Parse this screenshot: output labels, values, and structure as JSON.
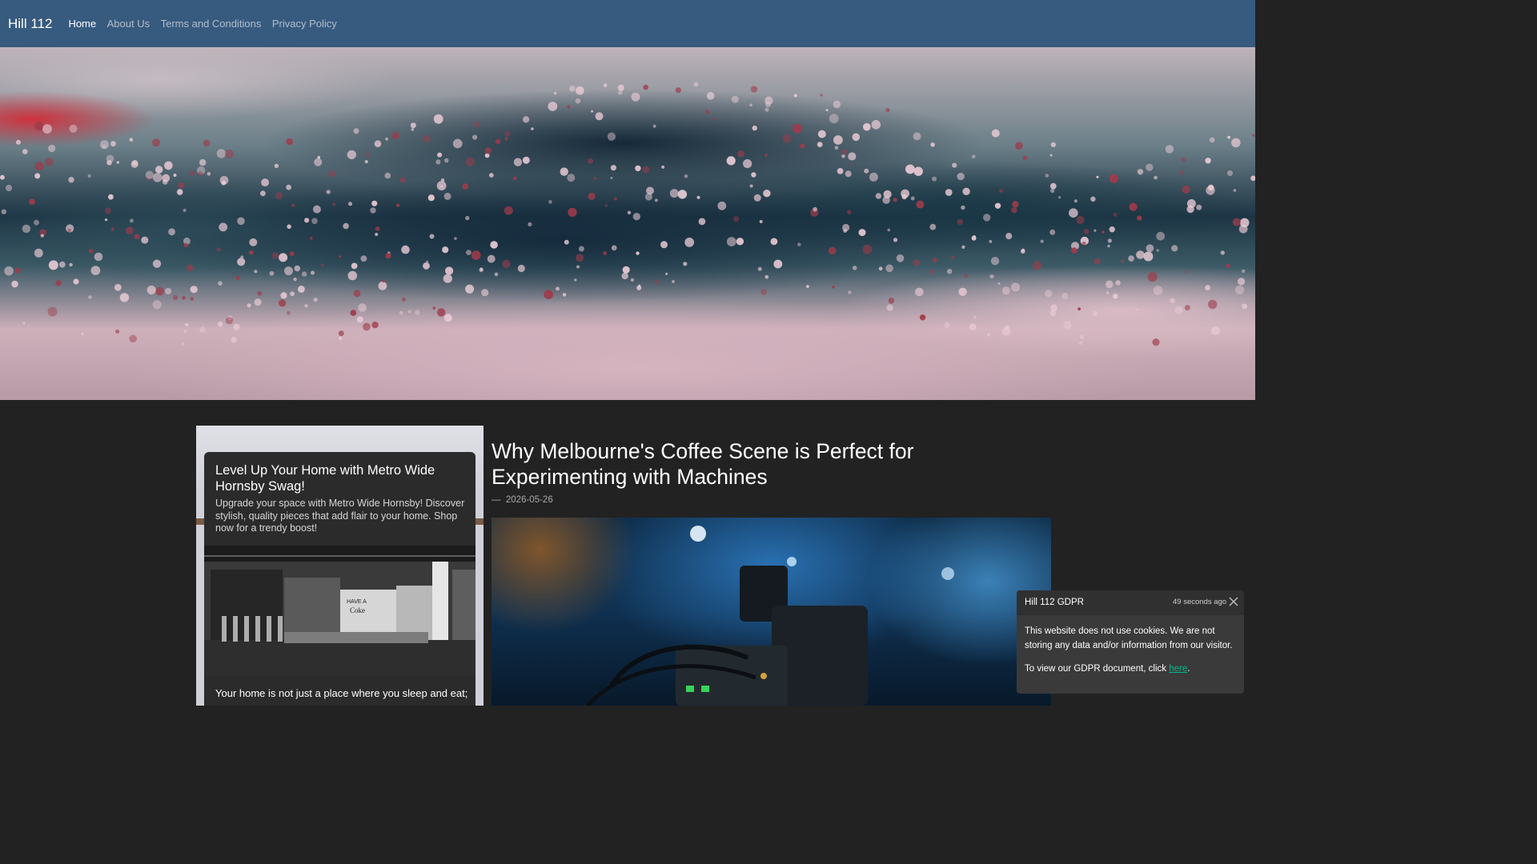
{
  "navbar": {
    "brand": "Hill 112",
    "links": [
      {
        "label": "Home",
        "active": true
      },
      {
        "label": "About Us",
        "active": false
      },
      {
        "label": "Terms and Conditions",
        "active": false
      },
      {
        "label": "Privacy Policy",
        "active": false
      }
    ]
  },
  "featured_card": {
    "title": "Level Up Your Home with Metro Wide Hornsby Swag!",
    "description": "Upgrade your space with Metro Wide Hornsby! Discover stylish, quality pieces that add flair to your home. Shop now for a trendy boost!",
    "image_sign_text": [
      "HAVE A",
      "Coke"
    ],
    "body_text": "Your home is not just a place where you sleep and eat;"
  },
  "article": {
    "title": "Why Melbourne's Coffee Scene is Perfect for Experimenting with Machines",
    "date_prefix": "—",
    "date": "2026-05-26"
  },
  "gdpr_toast": {
    "title": "Hill 112 GDPR",
    "time": "49 seconds ago",
    "close_icon": "close-icon",
    "body": "This website does not use cookies. We are not storing any data and/or information from our visitor.",
    "document_text_before": "To view our GDPR document, click ",
    "document_link": "here",
    "document_text_after": "."
  },
  "colors": {
    "navbar_bg": "#375a7f",
    "page_bg": "#222222",
    "link_accent": "#00bc8c",
    "toast_bg": "#3a3a3a"
  }
}
